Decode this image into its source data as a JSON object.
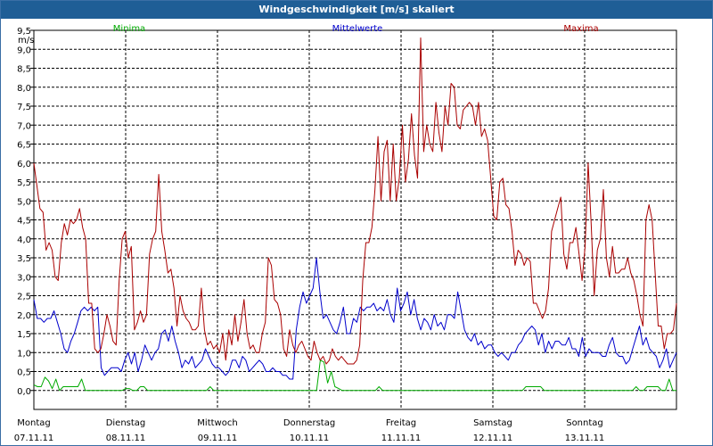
{
  "title": "Windgeschwindigkeit [m/s] skaliert",
  "chart_data": {
    "type": "line",
    "ylabel": "m/s",
    "ylim": [
      -0.5,
      9.5
    ],
    "yticks": [
      "0,0",
      "0,5",
      "1,0",
      "1,5",
      "2,0",
      "2,5",
      "3,0",
      "3,5",
      "4,0",
      "4,5",
      "5,0",
      "5,5",
      "6,0",
      "6,5",
      "7,0",
      "7,5",
      "8,0",
      "8,5",
      "9,0",
      "9,5"
    ],
    "grid": true,
    "legend_position": "top",
    "days": [
      {
        "day": "Montag",
        "date": "07.11.11"
      },
      {
        "day": "Dienstag",
        "date": "08.11.11"
      },
      {
        "day": "Mittwoch",
        "date": "09.11.11"
      },
      {
        "day": "Donnerstag",
        "date": "10.11.11"
      },
      {
        "day": "Freitag",
        "date": "11.11.11"
      },
      {
        "day": "Samstag",
        "date": "12.11.11"
      },
      {
        "day": "Sonntag",
        "date": "13.11.11"
      }
    ],
    "x_days_span": 7,
    "series": [
      {
        "name": "Minima",
        "color": "#00aa00",
        "values": [
          0.15,
          0.1,
          0.1,
          0.35,
          0.25,
          0.05,
          0.3,
          0.0,
          0.1,
          0.1,
          0.1,
          0.1,
          0.1,
          0.3,
          0.0,
          0.0,
          0.0,
          0.0,
          0.0,
          0.0,
          0.0,
          0.0,
          0.0,
          0.0,
          0.0,
          0.05,
          0.05,
          0.0,
          0.0,
          0.1,
          0.1,
          0.0,
          0.0,
          0.0,
          0.0,
          0.0,
          0.0,
          0.0,
          0.0,
          0.0,
          0.0,
          0.0,
          0.0,
          0.0,
          0.0,
          0.0,
          0.0,
          0.0,
          0.1,
          0.0,
          0.0,
          0.0,
          0.0,
          0.0,
          0.0,
          0.0,
          0.0,
          0.0,
          0.0,
          0.0,
          0.0,
          0.0,
          0.0,
          0.0,
          0.0,
          0.0,
          0.0,
          0.0,
          0.0,
          0.0,
          0.0,
          0.0,
          0.0,
          0.0,
          0.0,
          0.0,
          0.0,
          0.0,
          0.8,
          0.75,
          0.2,
          0.5,
          0.1,
          0.05,
          0.0,
          0.0,
          0.0,
          0.0,
          0.0,
          0.0,
          0.0,
          0.0,
          0.0,
          0.0,
          0.1,
          0.0,
          0.0,
          0.0,
          0.0,
          0.0,
          0.0,
          0.0,
          0.0,
          0.0,
          0.0,
          0.0,
          0.0,
          0.0,
          0.0,
          0.0,
          0.0,
          0.0,
          0.0,
          0.0,
          0.0,
          0.0,
          0.0,
          0.0,
          0.0,
          0.0,
          0.0,
          0.0,
          0.0,
          0.0,
          0.0,
          0.0,
          0.0,
          0.0,
          0.0,
          0.0,
          0.0,
          0.0,
          0.0,
          0.0,
          0.1,
          0.1,
          0.1,
          0.1,
          0.1,
          0.0,
          0.0,
          0.0,
          0.0,
          0.0,
          0.0,
          0.0,
          0.0,
          0.0,
          0.0,
          0.0,
          0.0,
          0.0,
          0.0,
          0.0,
          0.0,
          0.0,
          0.0,
          0.0,
          0.0,
          0.0,
          0.0,
          0.0,
          0.0,
          0.0,
          0.1,
          0.0,
          0.0,
          0.1,
          0.1,
          0.1,
          0.1,
          0.0,
          0.0,
          0.3,
          0.0,
          0.0
        ]
      },
      {
        "name": "Mittelwerte",
        "color": "#0000cc",
        "values": [
          2.4,
          1.9,
          1.9,
          1.8,
          1.9,
          1.9,
          2.1,
          1.8,
          1.5,
          1.1,
          1.0,
          1.3,
          1.5,
          1.8,
          2.1,
          2.2,
          2.1,
          2.2,
          2.1,
          2.2,
          0.6,
          0.4,
          0.5,
          0.6,
          0.6,
          0.6,
          0.5,
          0.8,
          1.0,
          0.7,
          1.0,
          0.5,
          0.8,
          1.2,
          1.0,
          0.8,
          1.0,
          1.1,
          1.5,
          1.6,
          1.3,
          1.7,
          1.3,
          1.0,
          0.6,
          0.8,
          0.7,
          0.9,
          0.6,
          0.7,
          0.8,
          1.1,
          0.9,
          0.7,
          0.6,
          0.6,
          0.5,
          0.4,
          0.5,
          0.8,
          0.8,
          0.6,
          0.9,
          0.8,
          0.5,
          0.6,
          0.7,
          0.8,
          0.7,
          0.5,
          0.5,
          0.6,
          0.5,
          0.5,
          0.4,
          0.4,
          0.3,
          0.3,
          1.6,
          2.2,
          2.6,
          2.3,
          2.5,
          2.7,
          3.5,
          2.6,
          1.9,
          2.0,
          1.8,
          1.6,
          1.5,
          1.8,
          2.2,
          1.5,
          1.5,
          1.9,
          1.8,
          2.2,
          2.1,
          2.2,
          2.2,
          2.3,
          2.1,
          2.2,
          2.1,
          2.4,
          2.0,
          1.8,
          2.7,
          2.1,
          2.3,
          2.6,
          2.0,
          2.4,
          1.9,
          1.6,
          1.9,
          1.8,
          1.6,
          2.0,
          1.7,
          1.8,
          1.6,
          2.0,
          2.0,
          1.9,
          2.6,
          2.1,
          1.6,
          1.4,
          1.3,
          1.5,
          1.2,
          1.3,
          1.1,
          1.2,
          1.2,
          1.0,
          0.9,
          1.0,
          0.9,
          0.8,
          1.0,
          1.0,
          1.2,
          1.3,
          1.5,
          1.6,
          1.7,
          1.6,
          1.2,
          1.5,
          1.0,
          1.3,
          1.1,
          1.3,
          1.3,
          1.2,
          1.2,
          1.4,
          1.1,
          1.1,
          0.9,
          1.4,
          0.9,
          1.1,
          1.0,
          1.0,
          1.0,
          0.9,
          0.9,
          1.2,
          1.4,
          1.0,
          0.9,
          0.9,
          0.7,
          0.8,
          1.1,
          1.4,
          1.7,
          1.2,
          1.4,
          1.1,
          1.0,
          0.9,
          0.6,
          0.8,
          1.1,
          0.6,
          0.8,
          1.0
        ]
      },
      {
        "name": "Maxima",
        "color": "#aa0000",
        "values": [
          6.0,
          5.4,
          4.8,
          4.7,
          3.7,
          3.9,
          3.7,
          3.0,
          2.9,
          3.9,
          4.4,
          4.1,
          4.5,
          4.4,
          4.5,
          4.8,
          4.3,
          4.0,
          2.3,
          2.3,
          1.1,
          1.0,
          1.1,
          1.5,
          2.0,
          1.7,
          1.3,
          1.2,
          2.9,
          4.0,
          4.2,
          3.5,
          3.8,
          1.6,
          1.8,
          2.1,
          1.8,
          2.0,
          3.6,
          4.0,
          4.2,
          5.7,
          4.2,
          3.7,
          3.1,
          3.2,
          2.7,
          1.7,
          2.5,
          2.1,
          1.9,
          1.8,
          1.6,
          1.6,
          1.7,
          2.7,
          1.6,
          1.2,
          1.3,
          1.1,
          1.2,
          1.0,
          1.5,
          0.8,
          1.6,
          1.2,
          2.0,
          1.3,
          1.8,
          2.4,
          1.5,
          1.1,
          1.2,
          1.0,
          1.0,
          1.5,
          1.8,
          3.5,
          3.3,
          2.4,
          2.3,
          2.0,
          1.1,
          0.9,
          1.6,
          1.2,
          1.0,
          1.2,
          1.3,
          1.1,
          0.9,
          0.8,
          1.3,
          1.0,
          0.8,
          0.9,
          0.7,
          0.8,
          1.1,
          0.9,
          0.8,
          0.9,
          0.8,
          0.7,
          0.7,
          0.7,
          0.8,
          1.2,
          2.9,
          3.9,
          3.9,
          4.3,
          5.3,
          6.7,
          5.0,
          6.3,
          6.6,
          5.0,
          6.5,
          5.0,
          5.6,
          7.0,
          5.5,
          6.1,
          7.3,
          6.2,
          5.6,
          9.3,
          6.3,
          7.0,
          6.5,
          6.3,
          7.6,
          6.8,
          6.3,
          7.5,
          7.0,
          8.1,
          8.0,
          7.0,
          6.9,
          7.4,
          7.5,
          7.6,
          7.5,
          7.0,
          7.6,
          6.7,
          6.9,
          6.6,
          5.6,
          4.6,
          4.5,
          5.5,
          5.6,
          4.9,
          4.8,
          4.2,
          3.3,
          3.7,
          3.6,
          3.3,
          3.5,
          3.4,
          2.3,
          2.3,
          2.1,
          1.9,
          2.1,
          2.7,
          4.2,
          4.5,
          4.8,
          5.1,
          3.6,
          3.2,
          3.9,
          3.9,
          4.3,
          3.6,
          2.9,
          3.8,
          6.0,
          4.4,
          2.5,
          3.7,
          4.0,
          5.3,
          3.5,
          3.0,
          3.8,
          3.1,
          3.1,
          3.2,
          3.2,
          3.5,
          3.1,
          2.9,
          2.5,
          2.0,
          1.7,
          4.5,
          4.9,
          4.5,
          3.1,
          1.7,
          1.7,
          1.1,
          1.5,
          1.5,
          1.6,
          2.3
        ]
      }
    ]
  }
}
